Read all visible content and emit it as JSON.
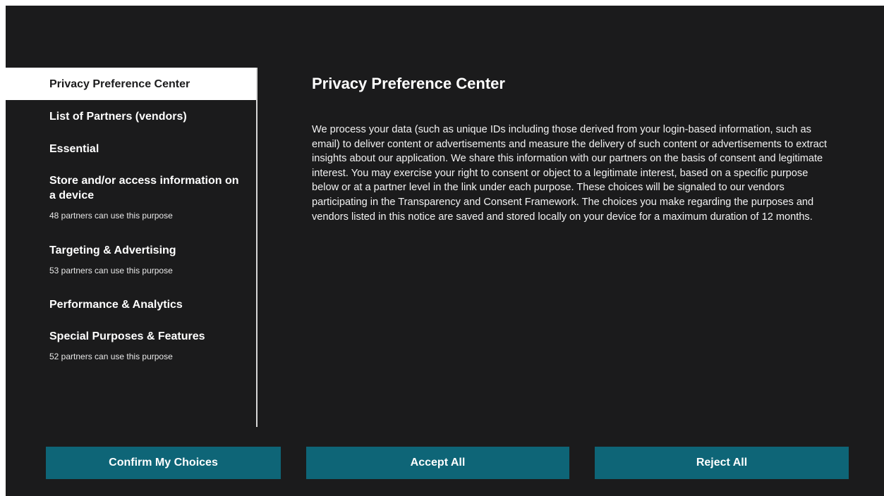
{
  "sidebar": {
    "items": [
      {
        "label": "Privacy Preference Center",
        "active": true
      },
      {
        "label": "List of Partners (vendors)"
      },
      {
        "label": "Essential"
      },
      {
        "label": "Store and/or access information on a device",
        "sub": "48 partners can use this purpose"
      },
      {
        "label": "Targeting & Advertising",
        "sub": "53 partners can use this purpose"
      },
      {
        "label": "Performance & Analytics"
      },
      {
        "label": "Special Purposes & Features",
        "sub": "52 partners can use this purpose"
      }
    ]
  },
  "main": {
    "title": "Privacy Preference Center",
    "body": "We process your data (such as unique IDs including those derived from your login-based information, such as email) to deliver content or advertisements and measure the delivery of such content or advertisements to extract insights about our application. We share this information with our partners on the basis of consent and legitimate interest. You may exercise your right to consent or object to a legitimate interest, based on a specific purpose below or at a partner level in the link under each purpose. These choices will be signaled to our vendors participating in the Transparency and Consent Framework. The choices you make regarding the purposes and vendors listed in this notice are saved and stored locally on your device for a maximum duration of 12 months."
  },
  "buttons": {
    "confirm": "Confirm My Choices",
    "accept_all": "Accept All",
    "reject_all": "Reject All"
  },
  "colors": {
    "background": "#1b1b1c",
    "accent": "#0e6577",
    "active_item_bg": "#ffffff"
  }
}
